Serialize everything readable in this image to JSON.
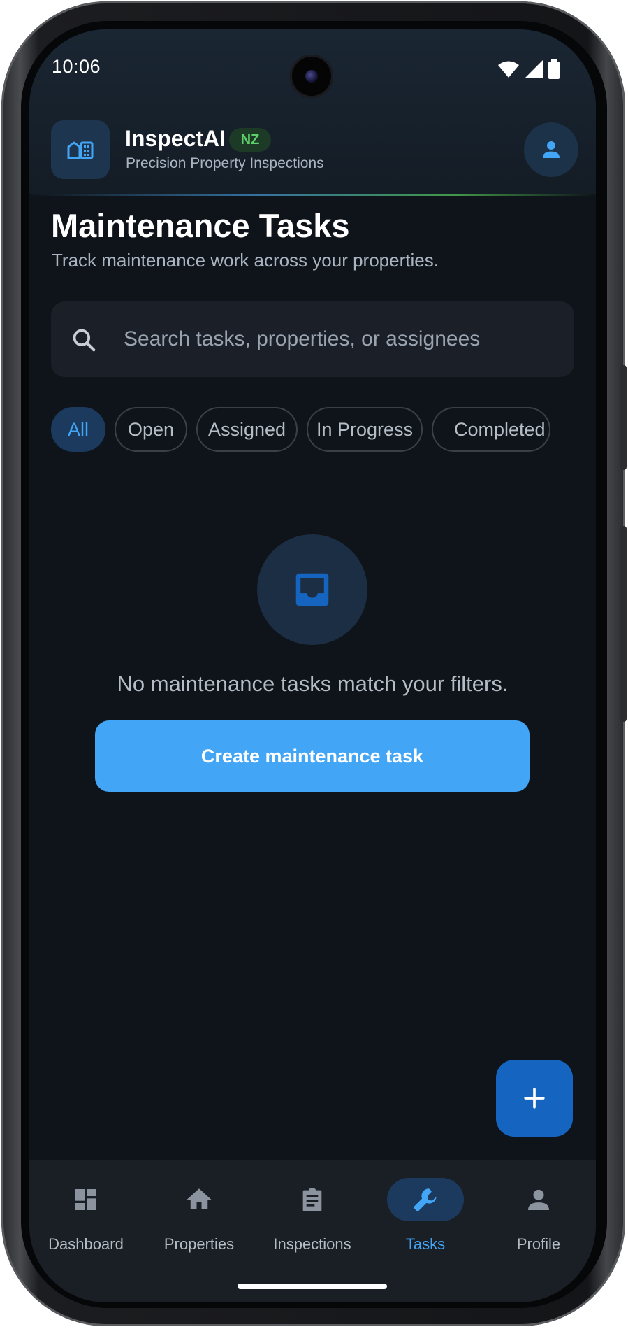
{
  "status_bar": {
    "time": "10:06"
  },
  "app_header": {
    "name": "InspectAI",
    "region_badge": "NZ",
    "tagline": "Precision Property Inspections"
  },
  "page": {
    "title": "Maintenance Tasks",
    "subtitle": "Track maintenance work across your properties."
  },
  "search": {
    "placeholder": "Search tasks, properties, or assignees",
    "value": ""
  },
  "filters": [
    {
      "label": "All",
      "active": true
    },
    {
      "label": "Open",
      "active": false
    },
    {
      "label": "Assigned",
      "active": false
    },
    {
      "label": "In Progress",
      "active": false
    },
    {
      "label": "Completed",
      "active": false
    }
  ],
  "empty_state": {
    "icon": "inbox-icon",
    "message": "No maintenance tasks match your filters.",
    "button_label": "Create maintenance task"
  },
  "fab": {
    "icon": "plus-icon"
  },
  "bottom_nav": [
    {
      "label": "Dashboard",
      "icon": "dashboard-icon",
      "active": false
    },
    {
      "label": "Properties",
      "icon": "home-icon",
      "active": false
    },
    {
      "label": "Inspections",
      "icon": "clipboard-icon",
      "active": false
    },
    {
      "label": "Tasks",
      "icon": "wrench-icon",
      "active": true
    },
    {
      "label": "Profile",
      "icon": "person-icon",
      "active": false
    }
  ],
  "colors": {
    "accent": "#42a5f5",
    "fab": "#1565c0",
    "background": "#0f141a",
    "badge_green": "#5fcf6a"
  }
}
